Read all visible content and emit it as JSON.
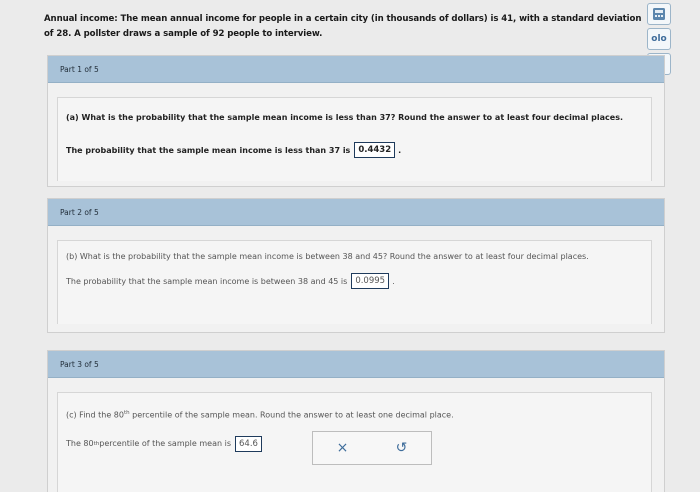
{
  "header": {
    "lead": "Annual income:",
    "text": "The mean annual income for people in a certain city (in thousands of dollars) is 41, with a standard deviation of 28. A pollster draws a sample of 92 people to interview."
  },
  "toolbar": {
    "icons": [
      "calculator-icon",
      "data-icon",
      "grid-icon"
    ],
    "data_label": "olo"
  },
  "parts": [
    {
      "label": "Part 1 of 5",
      "question": "(a) What is the probability that the sample mean income is less than 37? Round the answer to at least four decimal places.",
      "answer_prefix": "The probability that the sample mean income is less than 37 is",
      "answer": "0.4432",
      "answer_suffix": "."
    },
    {
      "label": "Part 2 of 5",
      "question": "(b) What is the probability that the sample mean income is between 38 and 45? Round the answer to at least four decimal places.",
      "answer_prefix": "The probability that the sample mean income is between 38 and 45 is",
      "answer": "0.0995",
      "answer_suffix": "."
    },
    {
      "label": "Part 3 of 5",
      "question_pre": "(c) Find the 80",
      "question_sup": "th",
      "question_post": " percentile of the sample mean. Round the answer to at least one decimal place.",
      "answer_pre": "The 80",
      "answer_sup": "th",
      "answer_post": " percentile of the sample mean is",
      "answer": "64.6"
    }
  ],
  "actions": {
    "clear": "×",
    "undo": "↺"
  }
}
